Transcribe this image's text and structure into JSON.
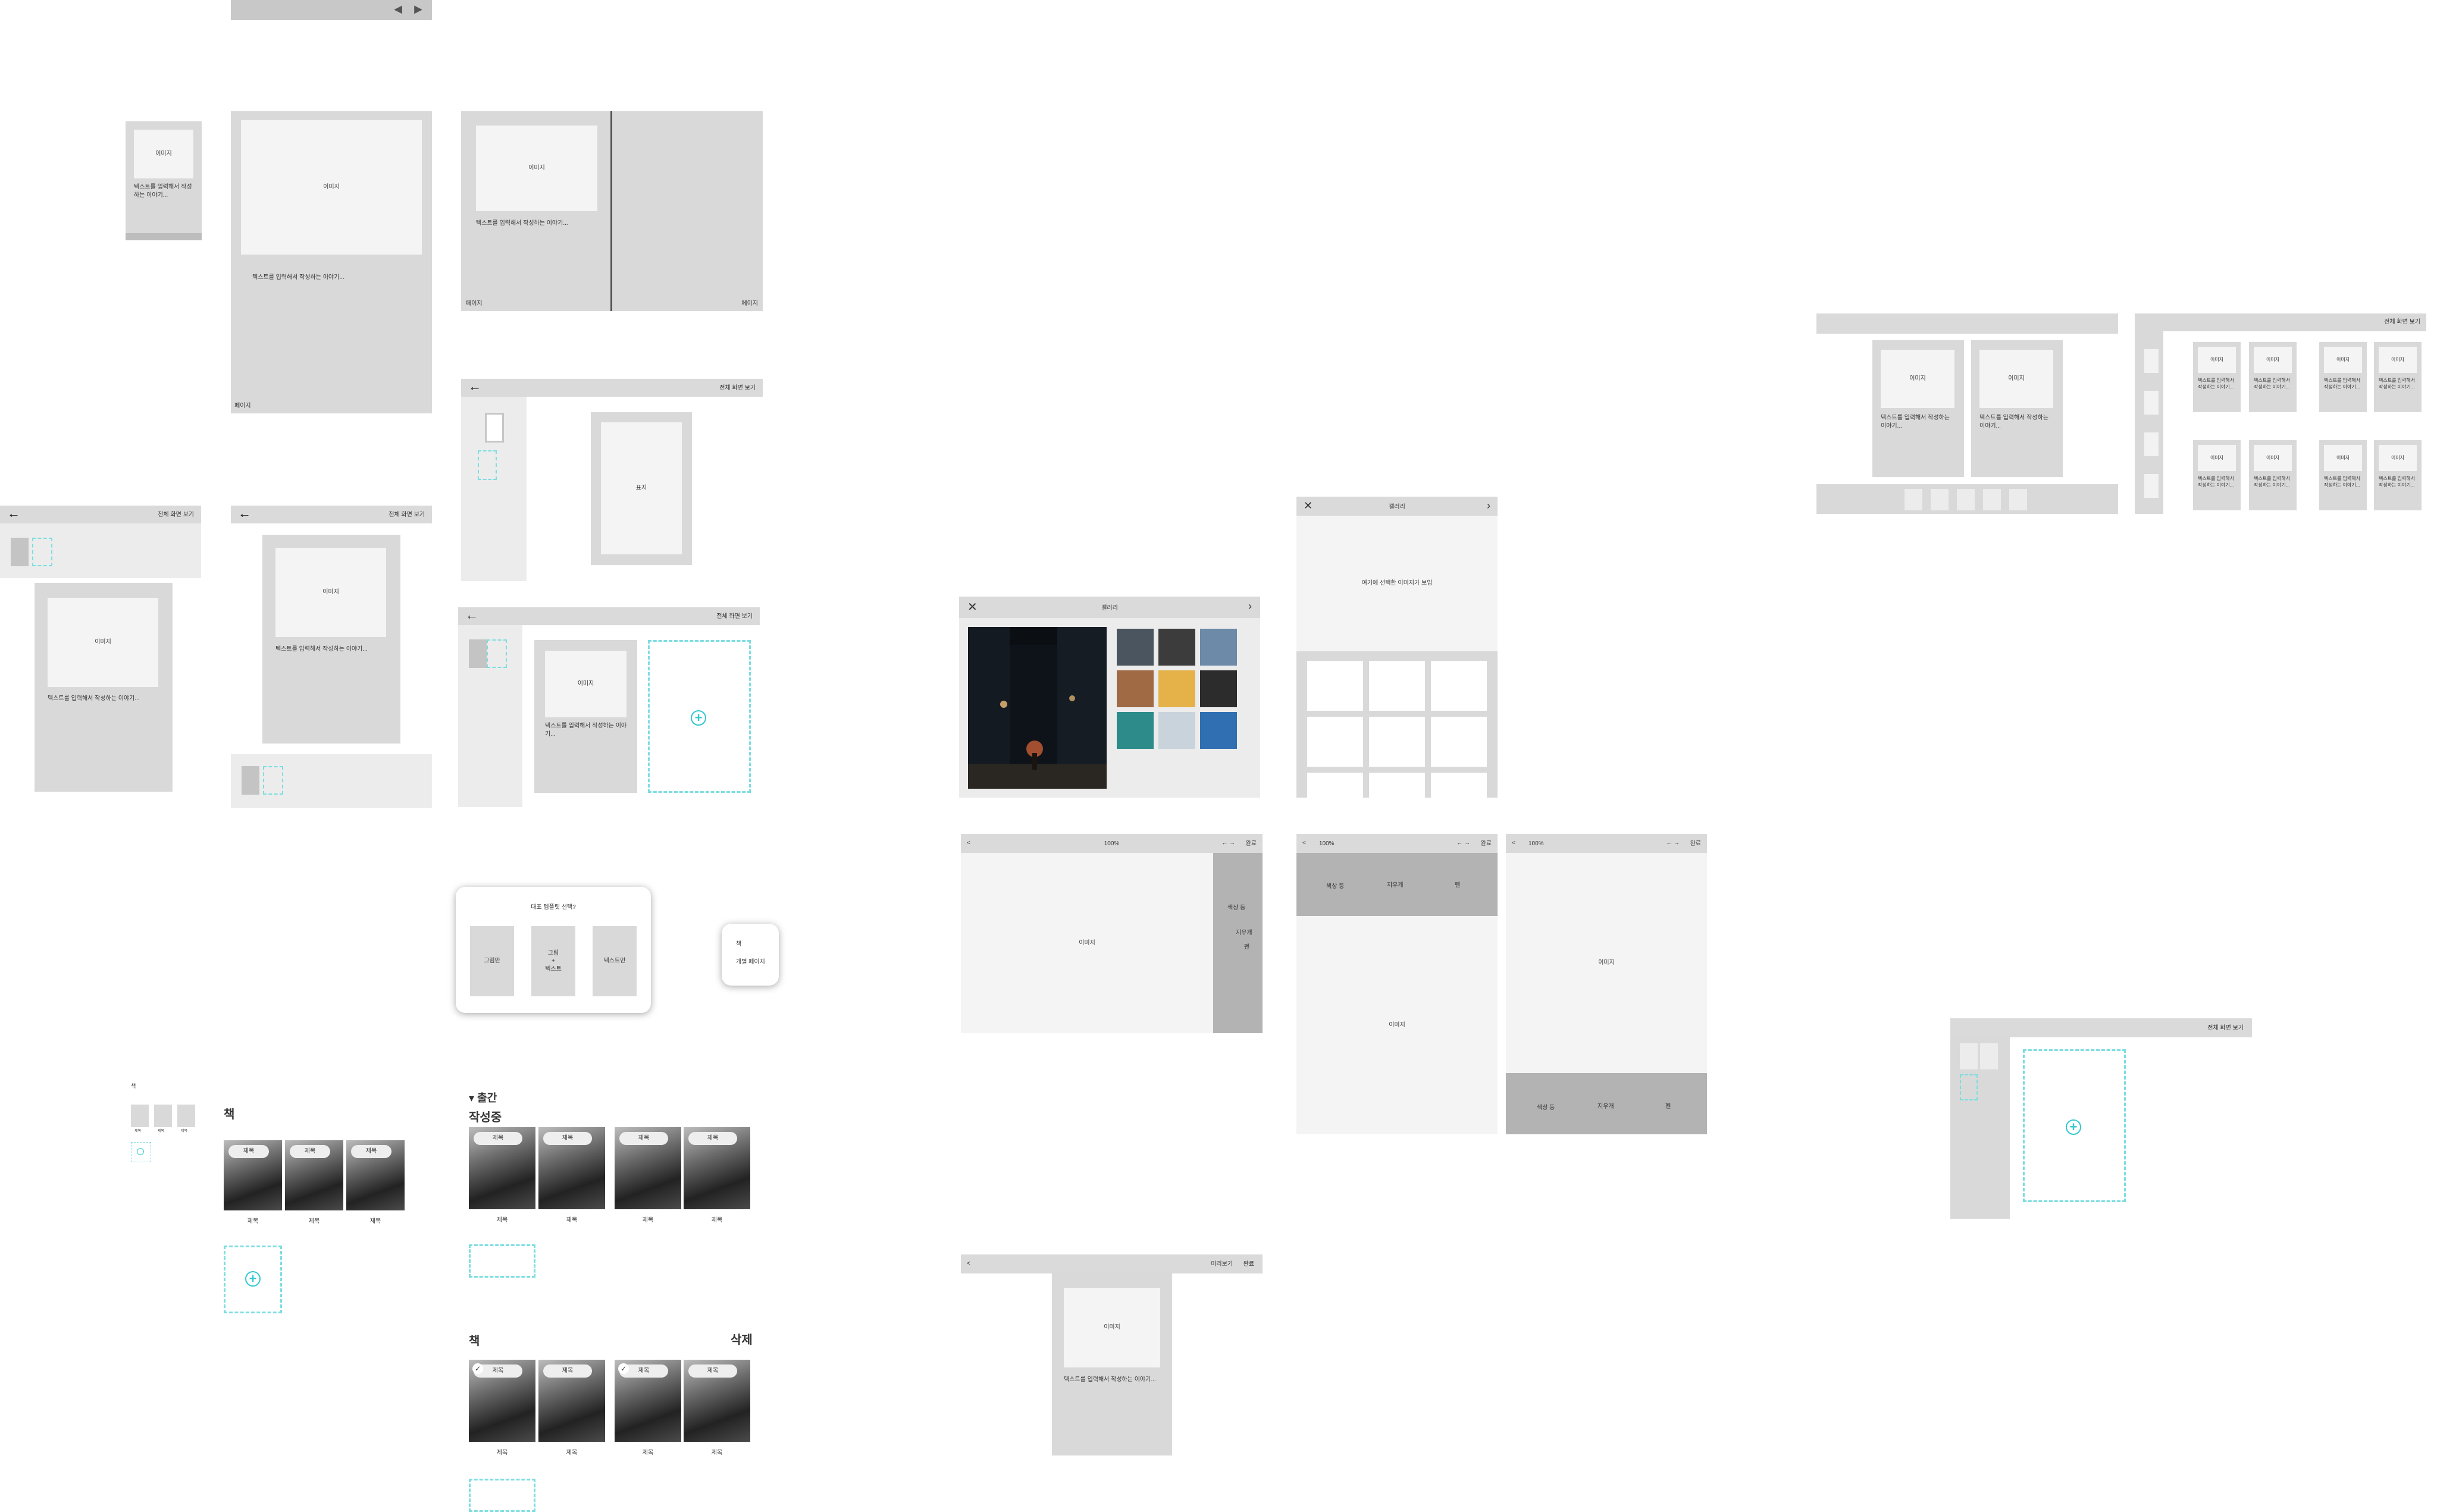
{
  "labels": {
    "image": "이미지",
    "image_alt": "이미지",
    "body_text": "텍스트를 입력해서 작성하는 이야기...",
    "body_text_a": "텍스트를 입력해서 작성하는 이야기...",
    "body_text_b": "텍스트를 입력해서 작성하는 이야기...",
    "body_text_c": "텍스트를 입력해서 작성하는 이야기...",
    "page_no": "페이지",
    "left_page": "페이지",
    "right_page": "페이지",
    "cover": "표지",
    "full_screen": "전체 화면 보기",
    "full_screen_a": "전체 화면 보기",
    "full_screen_b": "전체 화면 보기",
    "full_screen_c": "전체 화면 보기",
    "full_screen_d": "전체 화면 보기",
    "full_screen_e": "전체 화면 보기",
    "gallery": "갤러리",
    "gallery_b": "갤러리",
    "gallery_placeholder": "여기에 선택한 이미지가 보임",
    "zoom_a": "100%",
    "zoom_b": "100%",
    "zoom_c": "100%",
    "done_a": "완료",
    "done_b": "완료",
    "done_c": "완료",
    "preview": "미리보기",
    "side_a": "색상 등",
    "side_b": "지우개",
    "side_c": "펜",
    "tool_a": "색상 등",
    "tool_b": "지우개",
    "tool_c": "펜",
    "btool_a": "색상 등",
    "btool_b": "지우개",
    "btool_c": "펜",
    "dialog_title": "대표 템플릿 선택?",
    "opt_picture": "그림만",
    "opt_picture_text": "그림\n+\n텍스트",
    "opt_text": "텍스트만",
    "mini_a": "책",
    "mini_b": "개별 페이지",
    "tiny_book": "책",
    "tiny_a": "제목",
    "tiny_b": "제목",
    "tiny_c": "제목",
    "book_heading": "책",
    "published": "▾ 출간",
    "in_progress": "작성중",
    "book_heading2": "책",
    "delete": "삭제",
    "card_title": "제목"
  },
  "books": {
    "row1": [
      "제목",
      "제목",
      "제목"
    ],
    "row2": [
      "제목",
      "제목",
      "제목",
      "제목"
    ],
    "row3": [
      "제목",
      "제목",
      "제목",
      "제목"
    ]
  },
  "colors": {
    "accent": "#34c9cf",
    "wire_gray": "#d9d9d9",
    "wire_light": "#f4f4f4",
    "wire_dark": "#b3b3b3"
  },
  "icons": {
    "back": "arrow-left-icon",
    "close": "close-icon",
    "next": "chevron-right-icon",
    "add": "plus-circle-icon",
    "check": "check-icon"
  }
}
